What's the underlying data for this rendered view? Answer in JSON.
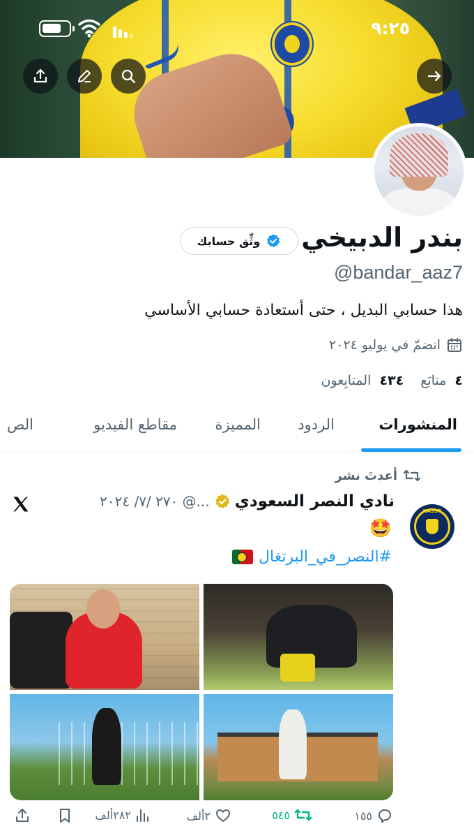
{
  "status_bar": {
    "time": "٩:٢٥"
  },
  "profile": {
    "display_name": "بندر الدبيخي",
    "handle": "@bandar_aaz7",
    "verify_button_label": "وثِّق حسابك",
    "bio": "هذا حسابي البديل ، حتى أستعادة حسابي الأساسي",
    "joined": "انضمّ في يوليو ٢٠٢٤",
    "following_count": "٤",
    "following_label": "متابَع",
    "followers_count": "٤٣٤",
    "followers_label": "المتابِعون"
  },
  "tabs": [
    {
      "label": "المنشورات",
      "active": true
    },
    {
      "label": "الردود",
      "active": false
    },
    {
      "label": "المميزة",
      "active": false
    },
    {
      "label": "مقاطع الفيديو",
      "active": false
    },
    {
      "label": "الص",
      "active": false
    }
  ],
  "tweet": {
    "repost_label": "أعدتَ نشر",
    "author_name": "نادي النصر السعودي",
    "meta": "...@ ٢٧٠ /٧/ ٢٠٢٤",
    "emoji": "🤩",
    "hashtag": "#النصر_في_البرتغال",
    "avatar_text": "NASSR",
    "actions": {
      "replies": "١٥٥",
      "reposts": "٥٤٥",
      "likes": "٢ألف",
      "views": "٢٨٢ألف"
    }
  },
  "colors": {
    "accent": "#1d9bf0",
    "repost_green": "#00ba7c",
    "verified_badge": "#1d9bf0",
    "gold_badge": "#e2b719"
  }
}
